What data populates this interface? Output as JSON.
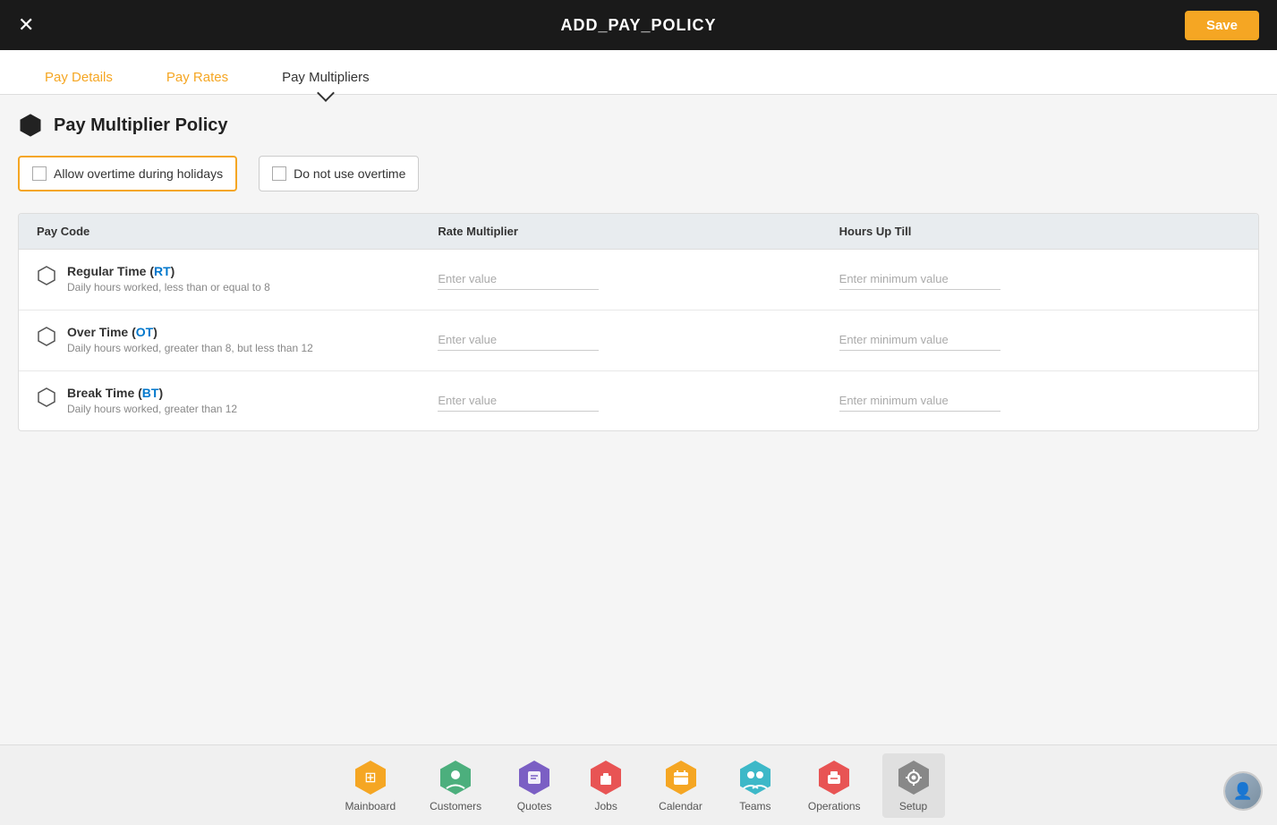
{
  "topBar": {
    "title": "ADD_PAY_POLICY",
    "closeLabel": "✕",
    "saveLabel": "Save"
  },
  "tabs": [
    {
      "id": "pay-details",
      "label": "Pay Details",
      "active": false
    },
    {
      "id": "pay-rates",
      "label": "Pay Rates",
      "active": false
    },
    {
      "id": "pay-multipliers",
      "label": "Pay Multipliers",
      "active": true
    }
  ],
  "section": {
    "title": "Pay Multiplier Policy"
  },
  "checkboxes": [
    {
      "id": "allow-overtime",
      "label": "Allow overtime during holidays",
      "checked": false,
      "highlighted": true
    },
    {
      "id": "no-overtime",
      "label": "Do not use overtime",
      "checked": false,
      "highlighted": false
    }
  ],
  "tableHeaders": [
    "Pay Code",
    "Rate Multiplier",
    "Hours Up Till"
  ],
  "tableRows": [
    {
      "payCodeName": "Regular Time (RT)",
      "payCodeNameHighlight": "RT",
      "description": "Daily hours worked, less than or equal to 8",
      "ratePlaceholder": "Enter value",
      "hoursPlaceholder": "Enter minimum value"
    },
    {
      "payCodeName": "Over Time (OT)",
      "payCodeNameHighlight": "OT",
      "description": "Daily hours worked, greater than 8, but less than 12",
      "ratePlaceholder": "Enter value",
      "hoursPlaceholder": "Enter minimum value"
    },
    {
      "payCodeName": "Break Time (BT)",
      "payCodeNameHighlight": "BT",
      "description": "Daily hours worked, greater than 12",
      "ratePlaceholder": "Enter value",
      "hoursPlaceholder": "Enter minimum value"
    }
  ],
  "bottomNav": [
    {
      "id": "mainboard",
      "label": "Mainboard",
      "icon": "mainboard",
      "color": "#f5a623",
      "active": false
    },
    {
      "id": "customers",
      "label": "Customers",
      "icon": "customers",
      "color": "#4caf7d",
      "active": false
    },
    {
      "id": "quotes",
      "label": "Quotes",
      "icon": "quotes",
      "color": "#7b5fc4",
      "active": false
    },
    {
      "id": "jobs",
      "label": "Jobs",
      "icon": "jobs",
      "color": "#e85454",
      "active": false
    },
    {
      "id": "calendar",
      "label": "Calendar",
      "icon": "calendar",
      "color": "#f5a623",
      "active": false
    },
    {
      "id": "teams",
      "label": "Teams",
      "icon": "teams",
      "color": "#3db8c8",
      "active": false
    },
    {
      "id": "operations",
      "label": "Operations",
      "icon": "operations",
      "color": "#e85454",
      "active": false
    },
    {
      "id": "setup",
      "label": "Setup",
      "icon": "setup",
      "color": "#888888",
      "active": true
    }
  ]
}
